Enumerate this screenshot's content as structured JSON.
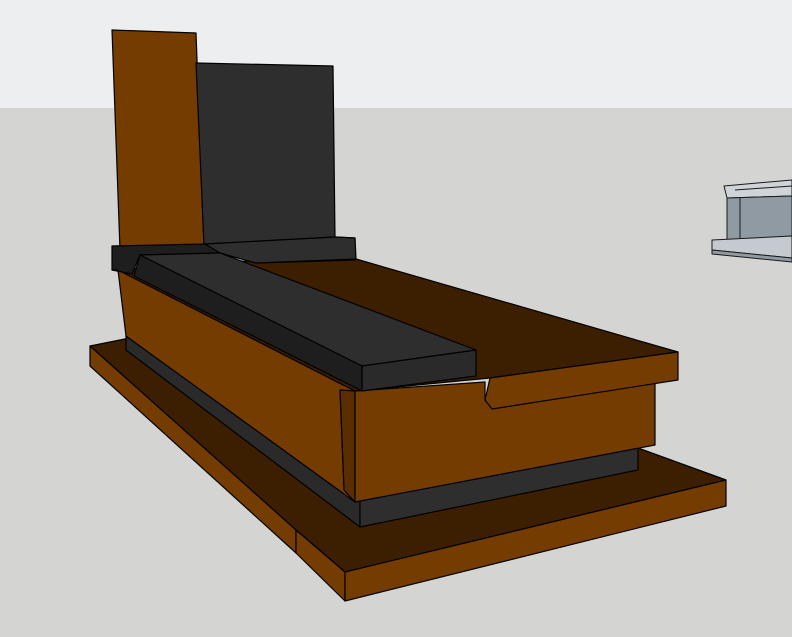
{
  "scene": {
    "sky_color": "#eceeef",
    "ground_color": "#d4d4d2",
    "wood_color": "#743c00",
    "wood_dark_color": "#3c1e00",
    "stone_color": "#2e2e2e",
    "stone_dark_color": "#1e1e1e",
    "edge_color": "#000000",
    "distant_object_color": "#8f9aa3"
  }
}
